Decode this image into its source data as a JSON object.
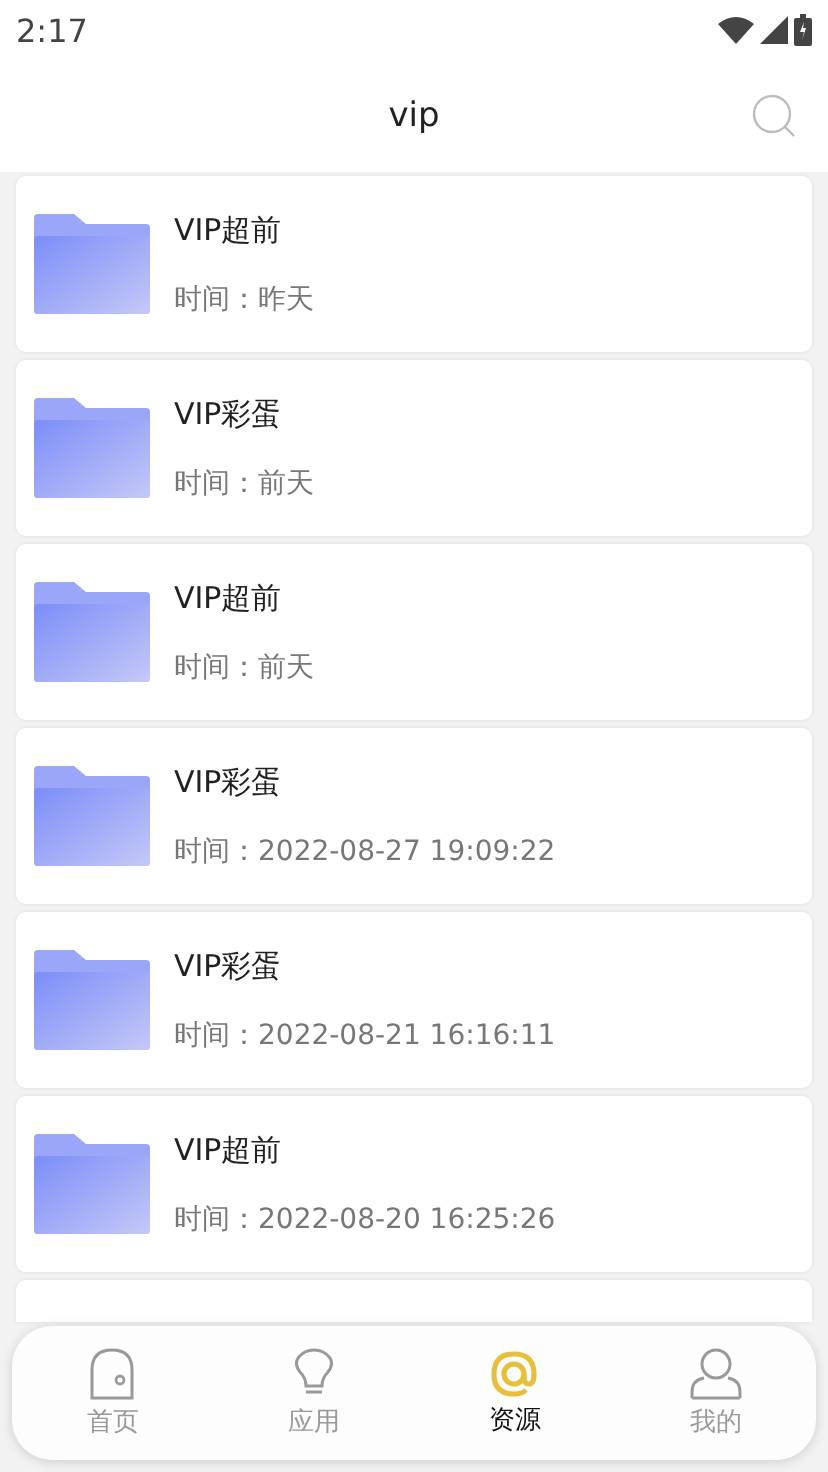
{
  "status_bar": {
    "time": "2:17"
  },
  "header": {
    "title": "vip"
  },
  "items": [
    {
      "title": "VIP超前",
      "time": "时间：昨天"
    },
    {
      "title": "VIP彩蛋",
      "time": "时间：前天"
    },
    {
      "title": "VIP超前",
      "time": "时间：前天"
    },
    {
      "title": "VIP彩蛋",
      "time": "时间：2022-08-27 19:09:22"
    },
    {
      "title": "VIP彩蛋",
      "time": "时间：2022-08-21 16:16:11"
    },
    {
      "title": "VIP超前",
      "time": "时间：2022-08-20 16:25:26"
    }
  ],
  "tabs": [
    {
      "kind": "home",
      "label": "首页",
      "selected": false
    },
    {
      "kind": "apps",
      "label": "应用",
      "selected": false
    },
    {
      "kind": "resources",
      "label": "资源",
      "selected": true
    },
    {
      "kind": "mine",
      "label": "我的",
      "selected": false
    }
  ]
}
